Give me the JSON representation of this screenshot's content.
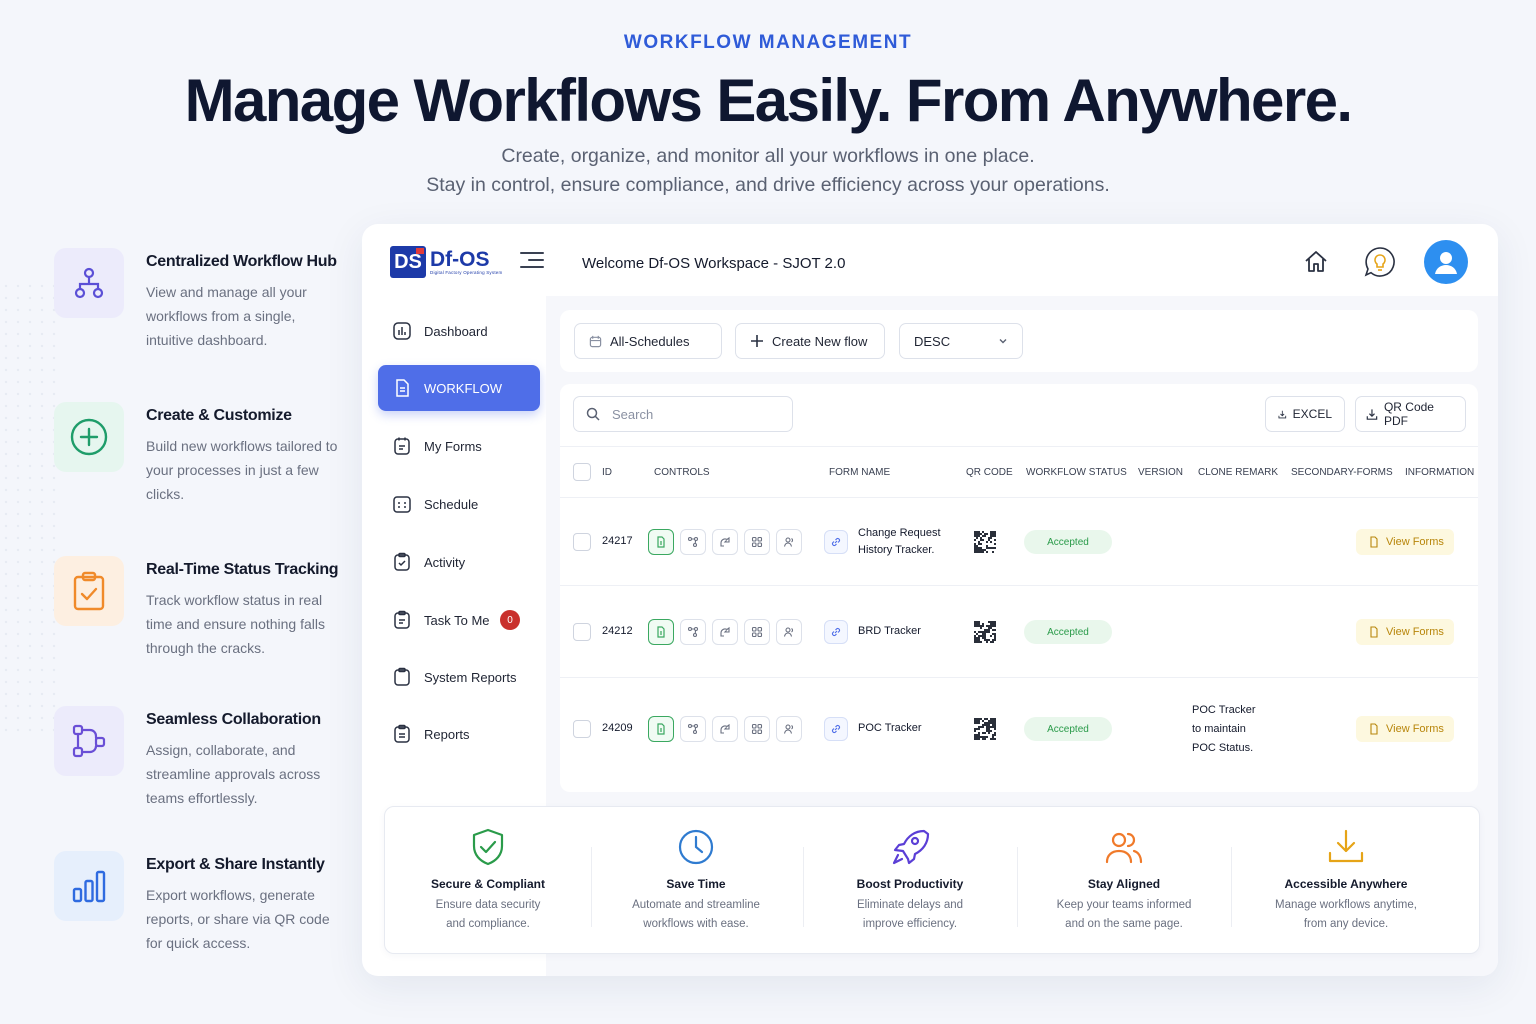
{
  "hero": {
    "eyebrow": "WORKFLOW MANAGEMENT",
    "headline": "Manage Workflows Easily. From Anywhere.",
    "subline1": "Create, organize, and monitor all your workflows in one place.",
    "subline2": "Stay in control, ensure compliance, and drive efficiency across your operations."
  },
  "features": [
    {
      "title": "Centralized Workflow Hub",
      "desc": "View and manage all your workflows from a single, intuitive dashboard.",
      "icon": "hierarchy-icon",
      "color": "#5b4fd6"
    },
    {
      "title": "Create & Customize",
      "desc": "Build new workflows tailored to your processes in just a few clicks.",
      "icon": "plus-circle-icon",
      "color": "#1f9d6a"
    },
    {
      "title": "Real-Time Status Tracking",
      "desc": "Track workflow status in real time and ensure nothing falls through the cracks.",
      "icon": "clipboard-check-icon",
      "color": "#f08a2a"
    },
    {
      "title": "Seamless Collaboration",
      "desc": "Assign, collaborate, and streamline approvals across teams effortlessly.",
      "icon": "flow-nodes-icon",
      "color": "#6a4fd6"
    },
    {
      "title": "Export & Share Instantly",
      "desc": "Export workflows, generate reports, or share via QR code for quick access.",
      "icon": "bar-chart-icon",
      "color": "#2f6be0"
    }
  ],
  "app": {
    "logo_main": "Df-OS",
    "logo_mark": "DS",
    "logo_tag": "Digital Factory Operating System",
    "welcome": "Welcome Df-OS Workspace - SJOT 2.0"
  },
  "sidebar": {
    "items": [
      {
        "label": "Dashboard",
        "icon": "dashboard-icon"
      },
      {
        "label": "WORKFLOW",
        "icon": "document-icon",
        "active": true
      },
      {
        "label": "My Forms",
        "icon": "forms-icon"
      },
      {
        "label": "Schedule",
        "icon": "schedule-icon"
      },
      {
        "label": "Activity",
        "icon": "activity-icon"
      },
      {
        "label": "Task To Me",
        "icon": "task-icon",
        "badge": "0"
      },
      {
        "label": "System Reports",
        "icon": "clipboard-icon"
      },
      {
        "label": "Reports",
        "icon": "reports-icon"
      }
    ]
  },
  "toolbar": {
    "schedules_label": "All-Schedules",
    "create_label": "Create New flow",
    "sort_value": "DESC",
    "search_placeholder": "Search",
    "excel_label": "EXCEL",
    "qr_pdf_label": "QR Code PDF"
  },
  "table": {
    "headers": [
      "ID",
      "CONTROLS",
      "FORM NAME",
      "QR CODE",
      "WORKFLOW STATUS",
      "VERSION",
      "CLONE REMARK",
      "SECONDARY-FORMS",
      "INFORMATION"
    ],
    "rows": [
      {
        "id": "24217",
        "form_name_1": "Change Request",
        "form_name_2": "History Tracker.",
        "status": "Accepted",
        "clone_1": "",
        "clone_2": "",
        "clone_3": "",
        "info": "View Forms"
      },
      {
        "id": "24212",
        "form_name_1": "BRD Tracker",
        "form_name_2": "",
        "status": "Accepted",
        "clone_1": "",
        "clone_2": "",
        "clone_3": "",
        "info": "View Forms"
      },
      {
        "id": "24209",
        "form_name_1": "POC Tracker",
        "form_name_2": "",
        "status": "Accepted",
        "clone_1": "POC Tracker",
        "clone_2": "to maintain",
        "clone_3": "POC Status.",
        "info": "View Forms"
      }
    ]
  },
  "benefits": [
    {
      "title": "Secure & Compliant",
      "desc1": "Ensure data security",
      "desc2": "and compliance.",
      "icon": "shield-check-icon",
      "color": "#2a9b4a"
    },
    {
      "title": "Save Time",
      "desc1": "Automate and streamline",
      "desc2": "workflows with ease.",
      "icon": "clock-icon",
      "color": "#2f7bd0"
    },
    {
      "title": "Boost Productivity",
      "desc1": "Eliminate delays and",
      "desc2": "improve efficiency.",
      "icon": "rocket-icon",
      "color": "#5b3fd6"
    },
    {
      "title": "Stay Aligned",
      "desc1": "Keep your teams informed",
      "desc2": "and on the same page.",
      "icon": "users-icon",
      "color": "#f07a2a"
    },
    {
      "title": "Accessible Anywhere",
      "desc1": "Manage workflows anytime,",
      "desc2": "from any device.",
      "icon": "download-icon",
      "color": "#e6a417"
    }
  ],
  "colors": {
    "accent": "#2f5bd8",
    "sidebar_active": "#4f6ee8",
    "status_accepted_bg": "#e9f7ec",
    "status_accepted_text": "#2a9b4a",
    "badge": "#c9302c"
  }
}
